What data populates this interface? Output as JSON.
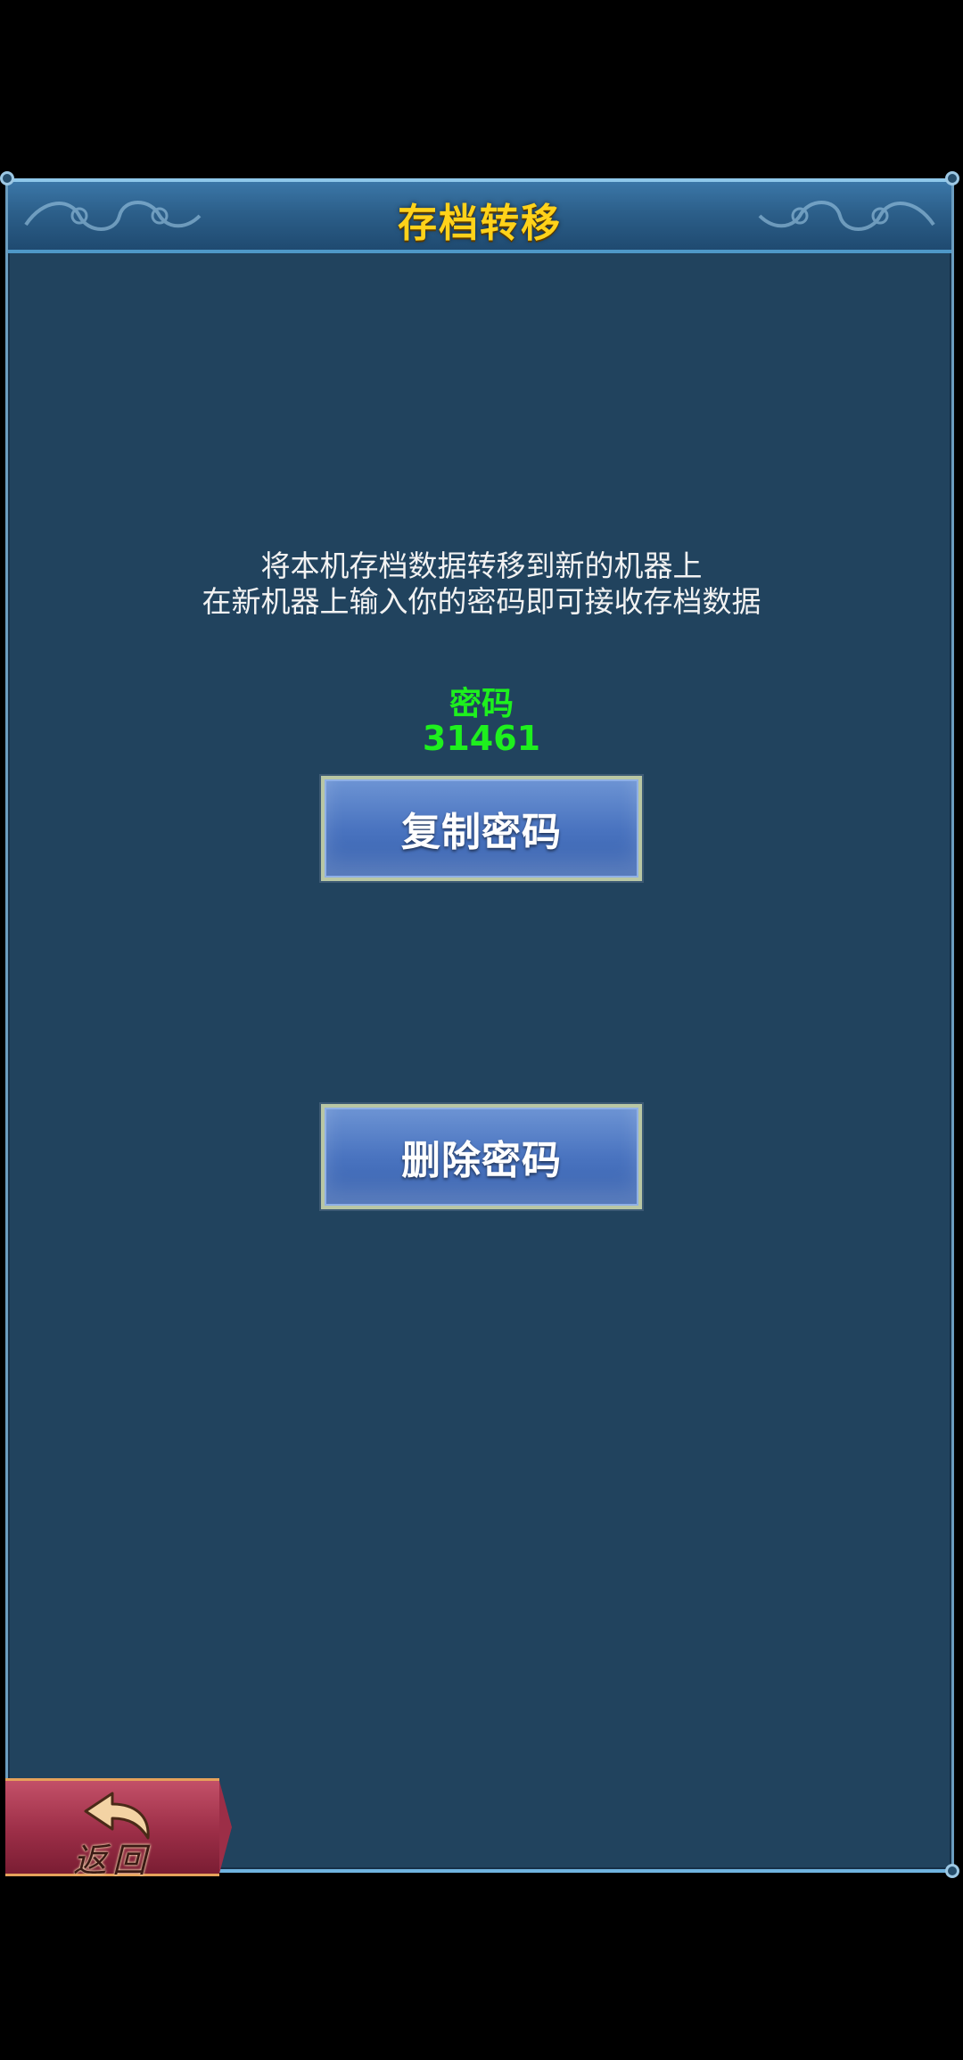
{
  "dialog": {
    "title": "存档转移",
    "description_line1": "将本机存档数据转移到新的机器上",
    "description_line2": "在新机器上输入你的密码即可接收存档数据",
    "password_label": "密码",
    "password_value": "31461"
  },
  "buttons": {
    "copy_password": "复制密码",
    "delete_password": "删除密码",
    "back": "返回"
  },
  "colors": {
    "panel_background": "#21435e",
    "title_color": "#ffd21a",
    "password_color": "#1ef01e",
    "button_blue": "#4a74c0",
    "back_button_red": "#9c2e47"
  },
  "icons": {
    "back": "back-arrow-icon"
  }
}
